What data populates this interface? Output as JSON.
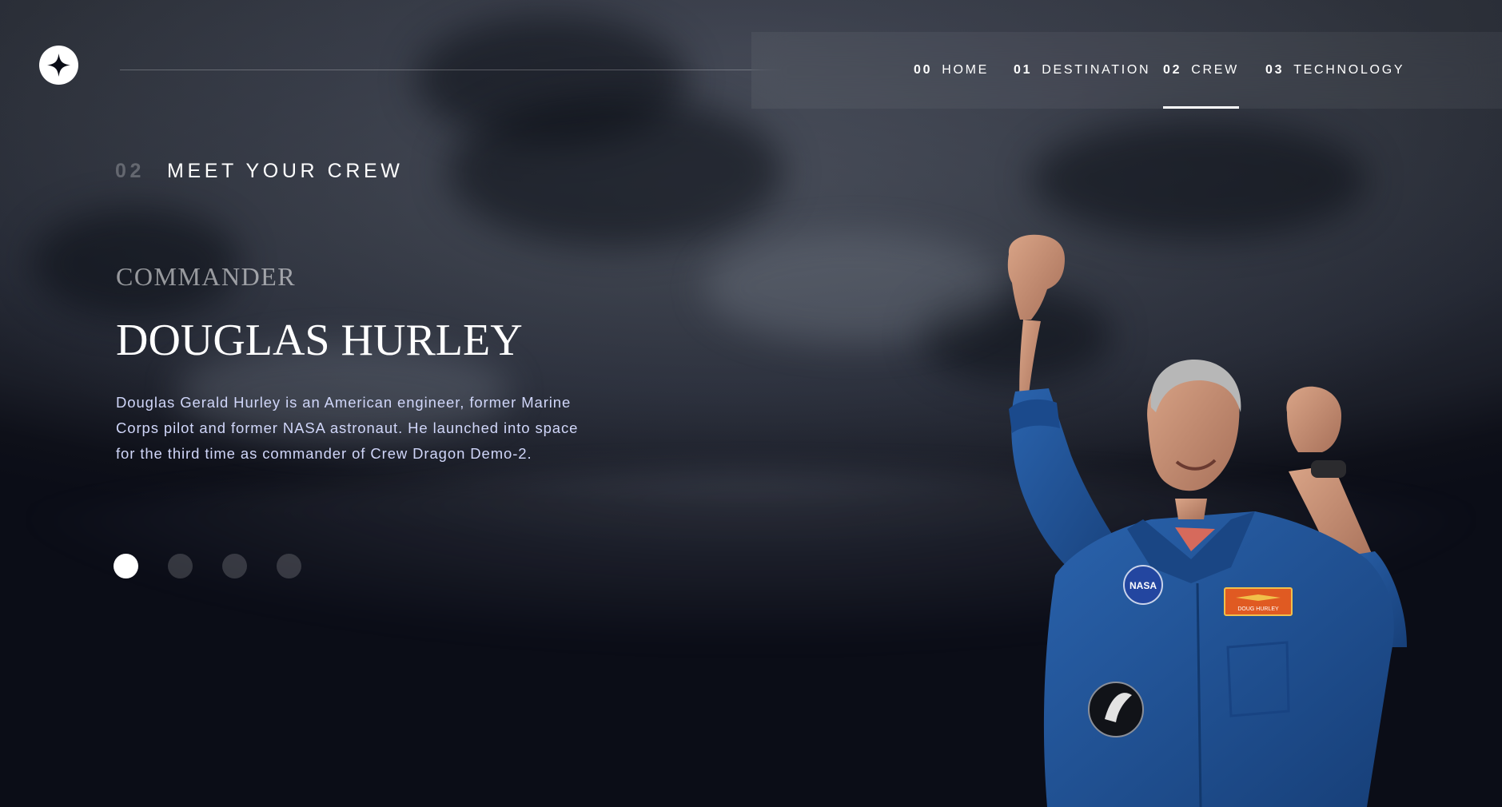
{
  "header": {
    "logo_icon": "star-icon",
    "nav": [
      {
        "num": "00",
        "label": "HOME",
        "active": false
      },
      {
        "num": "01",
        "label": "DESTINATION",
        "active": false
      },
      {
        "num": "02",
        "label": "CREW",
        "active": true
      },
      {
        "num": "03",
        "label": "TECHNOLOGY",
        "active": false
      }
    ]
  },
  "section": {
    "num": "02",
    "title": "MEET YOUR CREW"
  },
  "crew": {
    "role": "Commander",
    "name": "Douglas Hurley",
    "bio": "Douglas Gerald Hurley is an American engineer, former Marine Corps pilot and former NASA astronaut. He launched into space for the third time as commander of Crew Dragon Demo-2.",
    "patch_label": "NASA",
    "name_tag": "DOUG HURLEY"
  },
  "carousel": {
    "count": 4,
    "active_index": 0
  },
  "colors": {
    "background": "#0b0d17",
    "text": "#ffffff",
    "body_text": "#d0d6f9",
    "suit_blue": "#1f4f93"
  }
}
